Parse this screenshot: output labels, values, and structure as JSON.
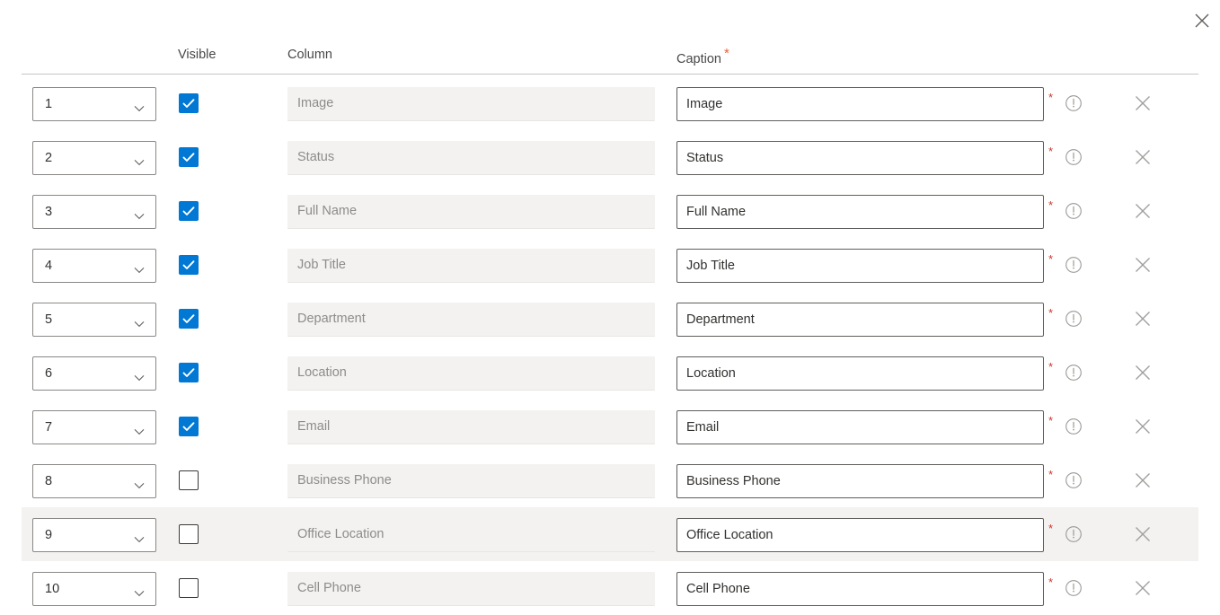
{
  "dialog": {
    "close_icon": "close-icon",
    "close_label": "Close"
  },
  "table": {
    "headers": {
      "order": "",
      "visible": "Visible",
      "column": "Column",
      "caption": "Caption",
      "caption_required_marker": "*"
    },
    "row_required_marker": "*",
    "info_icon": "info-circle-icon",
    "delete_icon": "close-icon",
    "dropdown_icon": "chevron-down-icon",
    "checkbox_checked_icon": "checkmark-icon",
    "rows": [
      {
        "order": "1",
        "visible": true,
        "column": "Image",
        "caption": "Image",
        "hovered": false
      },
      {
        "order": "2",
        "visible": true,
        "column": "Status",
        "caption": "Status",
        "hovered": false
      },
      {
        "order": "3",
        "visible": true,
        "column": "Full Name",
        "caption": "Full Name",
        "hovered": false
      },
      {
        "order": "4",
        "visible": true,
        "column": "Job Title",
        "caption": "Job Title",
        "hovered": false
      },
      {
        "order": "5",
        "visible": true,
        "column": "Department",
        "caption": "Department",
        "hovered": false
      },
      {
        "order": "6",
        "visible": true,
        "column": "Location",
        "caption": "Location",
        "hovered": false
      },
      {
        "order": "7",
        "visible": true,
        "column": "Email",
        "caption": "Email",
        "hovered": false
      },
      {
        "order": "8",
        "visible": false,
        "column": "Business Phone",
        "caption": "Business Phone",
        "hovered": false
      },
      {
        "order": "9",
        "visible": false,
        "column": "Office Location",
        "caption": "Office Location",
        "hovered": true
      },
      {
        "order": "10",
        "visible": false,
        "column": "Cell Phone",
        "caption": "Cell Phone",
        "hovered": false
      }
    ]
  },
  "colors": {
    "accent": "#0078d4",
    "required_header": "#e8633a",
    "required_row": "#c9372c",
    "hover_row": "#f3f2f1",
    "readonly_field": "#f3f2f1"
  }
}
